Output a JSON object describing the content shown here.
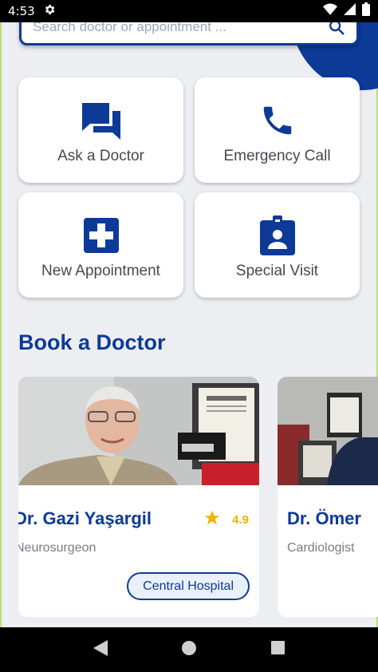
{
  "status_bar": {
    "time": "4:53"
  },
  "search": {
    "placeholder": "Search doctor or appointment ..."
  },
  "quick_actions": [
    {
      "label": "Ask a Doctor",
      "icon": "chat-icon"
    },
    {
      "label": "Emergency Call",
      "icon": "phone-icon"
    },
    {
      "label": "New Appointment",
      "icon": "medical-cross-icon"
    },
    {
      "label": "Special Visit",
      "icon": "badge-icon"
    }
  ],
  "section": {
    "title": "Book a Doctor"
  },
  "doctors": [
    {
      "name": "Dr. Gazi Yaşargil",
      "specialty": "Neurosurgeon",
      "rating": "4.9",
      "hospital": "Central Hospital"
    },
    {
      "name": "Dr. Ömer",
      "specialty": "Cardiologist"
    }
  ],
  "colors": {
    "primary": "#0d3a96",
    "rating": "#f2b300",
    "background": "#eceef2"
  }
}
